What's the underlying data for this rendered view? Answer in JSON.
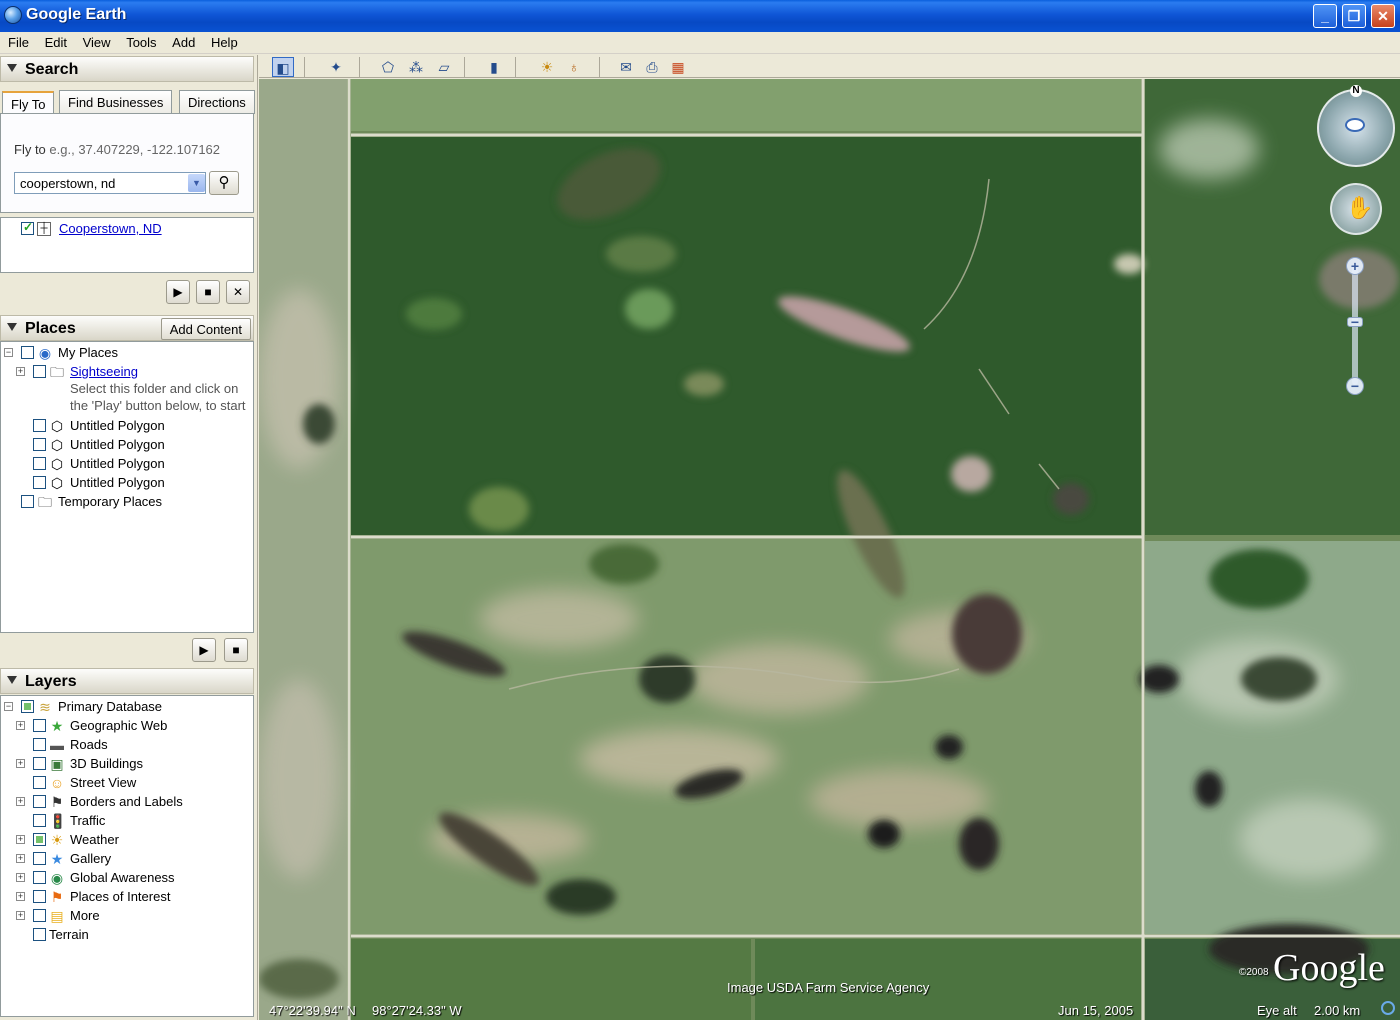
{
  "window": {
    "title": "Google Earth"
  },
  "menu": [
    "File",
    "Edit",
    "View",
    "Tools",
    "Add",
    "Help"
  ],
  "search": {
    "header": "Search",
    "tabs": [
      "Fly To",
      "Find Businesses",
      "Directions"
    ],
    "flyto_label": "Fly to",
    "flyto_hint": "e.g., 37.407229, -122.107162",
    "query": "cooperstown, nd",
    "result": "Cooperstown, ND"
  },
  "places": {
    "header": "Places",
    "add_content": "Add Content",
    "items": [
      {
        "label": "My Places"
      },
      {
        "label": "Sightseeing"
      },
      {
        "label": "Untitled Polygon"
      },
      {
        "label": "Untitled Polygon"
      },
      {
        "label": "Untitled Polygon"
      },
      {
        "label": "Untitled Polygon"
      },
      {
        "label": "Temporary Places"
      }
    ],
    "sightseeing_desc_1": "Select this folder and click on",
    "sightseeing_desc_2": "the 'Play' button below, to start"
  },
  "layers": {
    "header": "Layers",
    "items": [
      {
        "label": "Primary Database"
      },
      {
        "label": "Geographic Web"
      },
      {
        "label": "Roads"
      },
      {
        "label": "3D Buildings"
      },
      {
        "label": "Street View"
      },
      {
        "label": "Borders and Labels"
      },
      {
        "label": "Traffic"
      },
      {
        "label": "Weather"
      },
      {
        "label": "Gallery"
      },
      {
        "label": "Global Awareness"
      },
      {
        "label": "Places of Interest"
      },
      {
        "label": "More"
      },
      {
        "label": "Terrain"
      }
    ]
  },
  "map": {
    "credit": "Image USDA Farm Service Agency",
    "logo": "Google",
    "copyright": "©2008",
    "latitude": "47°22'39.94\" N",
    "longitude": "98°27'24.33\" W",
    "date": "Jun 15, 2005",
    "eye_alt_label": "Eye alt",
    "eye_alt_value": "2.00 km",
    "compass_n": "N"
  }
}
